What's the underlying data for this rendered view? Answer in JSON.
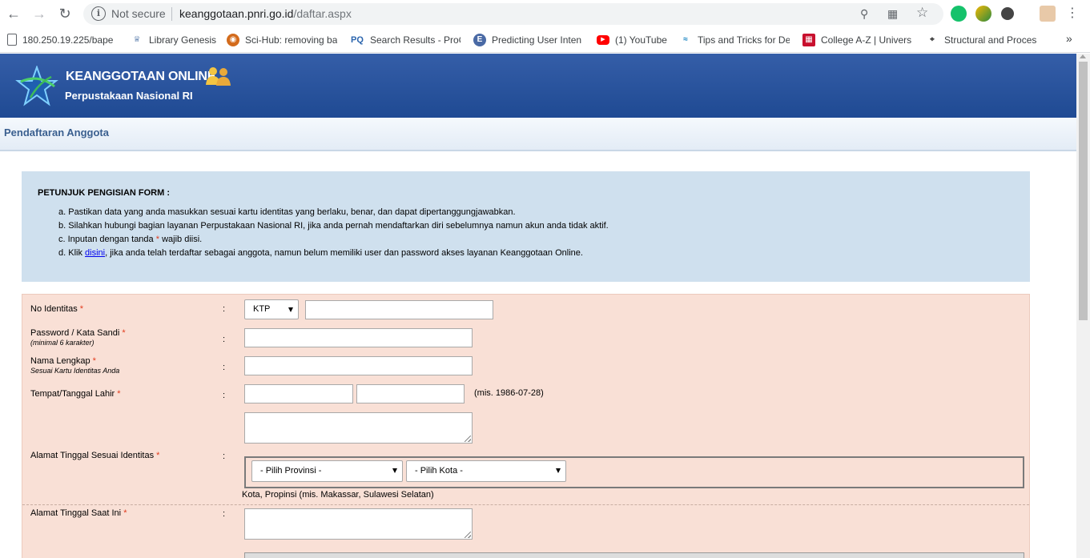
{
  "browser": {
    "security_label": "Not secure",
    "url_host": "keanggotaan.pnri.go.id",
    "url_path": "/daftar.aspx",
    "bookmarks": [
      {
        "label": "180.250.19.225/bape",
        "icon": "page-icon"
      },
      {
        "label": "Library Genesis",
        "icon": "library-genesis-icon"
      },
      {
        "label": "Sci-Hub: removing ba",
        "icon": "scihub-icon"
      },
      {
        "label": "Search Results - ProQ",
        "icon": "proquest-icon"
      },
      {
        "label": "Predicting User Inten",
        "icon": "predicting-icon"
      },
      {
        "label": "(1) YouTube",
        "icon": "youtube-icon"
      },
      {
        "label": "Tips and Tricks for De",
        "icon": "wifi-icon"
      },
      {
        "label": "College A-Z | Univers",
        "icon": "college-icon"
      },
      {
        "label": "Structural and Proces",
        "icon": "structural-icon"
      }
    ],
    "more_bookmarks": "»"
  },
  "banner": {
    "title": "KEANGGOTAAN ONLINE",
    "subtitle": "Perpustakaan Nasional RI"
  },
  "subheader": {
    "title": "Pendaftaran Anggota"
  },
  "instructions": {
    "title": "PETUNJUK PENGISIAN FORM :",
    "item_a": "a. Pastikan data yang anda masukkan sesuai kartu identitas yang berlaku, benar, dan dapat dipertanggungjawabkan.",
    "item_b": "b. Silahkan hubungi bagian layanan Perpustakaan Nasional RI, jika anda pernah mendaftarkan diri sebelumnya namun akun anda tidak aktif.",
    "item_c_prefix": "c. Inputan dengan tanda",
    "item_c_star": "*",
    "item_c_suffix": "wajib diisi.",
    "item_d_prefix": "d. Klik",
    "item_d_link": "disini",
    "item_d_suffix": ", jika anda telah terdaftar sebagai anggota, namun belum memiliki user dan password akses layanan Keanggotaan Online."
  },
  "form": {
    "required_mark": "*",
    "colon": ":",
    "no_identitas": {
      "label": "No Identitas",
      "type_selected": "KTP",
      "value": ""
    },
    "password": {
      "label": "Password / Kata Sandi",
      "hint": "(minimal 6 karakter)",
      "value": ""
    },
    "nama": {
      "label": "Nama Lengkap",
      "hint": "Sesuai Kartu Identitas Anda",
      "value": ""
    },
    "ttl": {
      "label": "Tempat/Tanggal Lahir",
      "tempat": "",
      "tanggal": "",
      "example": "(mis. 1986-07-28)"
    },
    "alamat_identitas": {
      "label": "Alamat Tinggal Sesuai Identitas",
      "value": "",
      "provinsi": "- Pilih Provinsi -",
      "kota": "- Pilih Kota -",
      "example": "Kota, Propinsi (mis. Makassar, Sulawesi Selatan)"
    },
    "alamat_saat_ini": {
      "label": "Alamat Tinggal Saat Ini",
      "value": ""
    }
  }
}
